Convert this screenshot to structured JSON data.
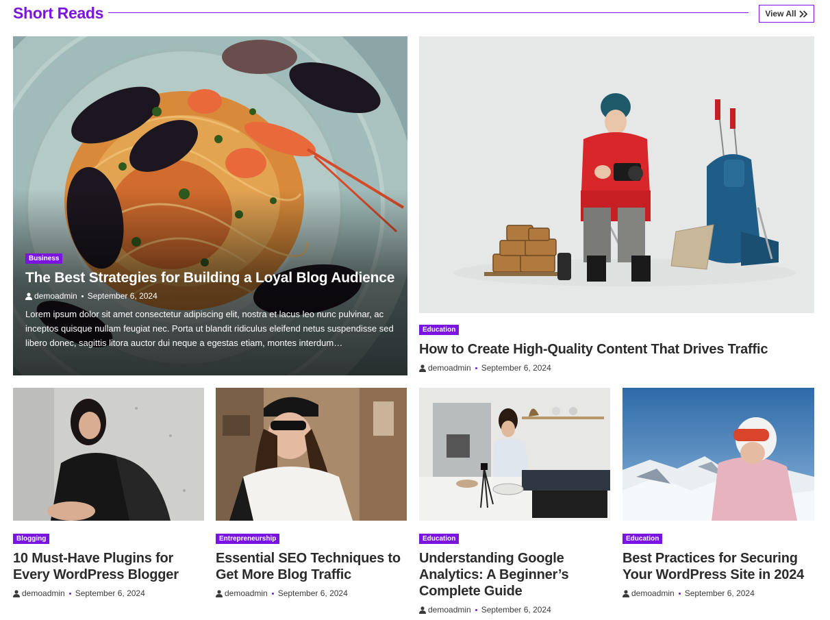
{
  "section": {
    "title": "Short Reads",
    "view_all": "View All"
  },
  "colors": {
    "accent": "#7b14e0",
    "text": "#2b2b2b"
  },
  "hero": {
    "category": "Business",
    "title": "The Best Strategies for Building a Loyal Blog Audience",
    "author": "demoadmin",
    "date": "September 6, 2024",
    "excerpt": "Lorem ipsum dolor sit amet consectetur adipiscing elit, nostra et lacus leo nunc pulvinar, ac inceptos quisque nullam feugiat nec. Porta ut blandit ridiculus eleifend netus suspendisse sed libero donec, sagittis litora auctor dui neque a egestas etiam, montes interdum…"
  },
  "feature": {
    "category": "Education",
    "title": "How to Create High-Quality Content That Drives Traffic",
    "author": "demoadmin",
    "date": "September 6, 2024"
  },
  "cards": [
    {
      "category": "Blogging",
      "title": "10 Must-Have Plugins for Every WordPress Blogger",
      "author": "demoadmin",
      "date": "September 6, 2024"
    },
    {
      "category": "Entrepreneurship",
      "title": "Essential SEO Techniques to Get More Blog Traffic",
      "author": "demoadmin",
      "date": "September 6, 2024"
    },
    {
      "category": "Education",
      "title": "Understanding Google Analytics: A Beginner’s Complete Guide",
      "author": "demoadmin",
      "date": "September 6, 2024"
    },
    {
      "category": "Education",
      "title": "Best Practices for Securing Your WordPress Site in 2024",
      "author": "demoadmin",
      "date": "September 6, 2024"
    }
  ],
  "icons": {
    "user": "user-icon",
    "view_all": "double-chevron-right-icon"
  }
}
